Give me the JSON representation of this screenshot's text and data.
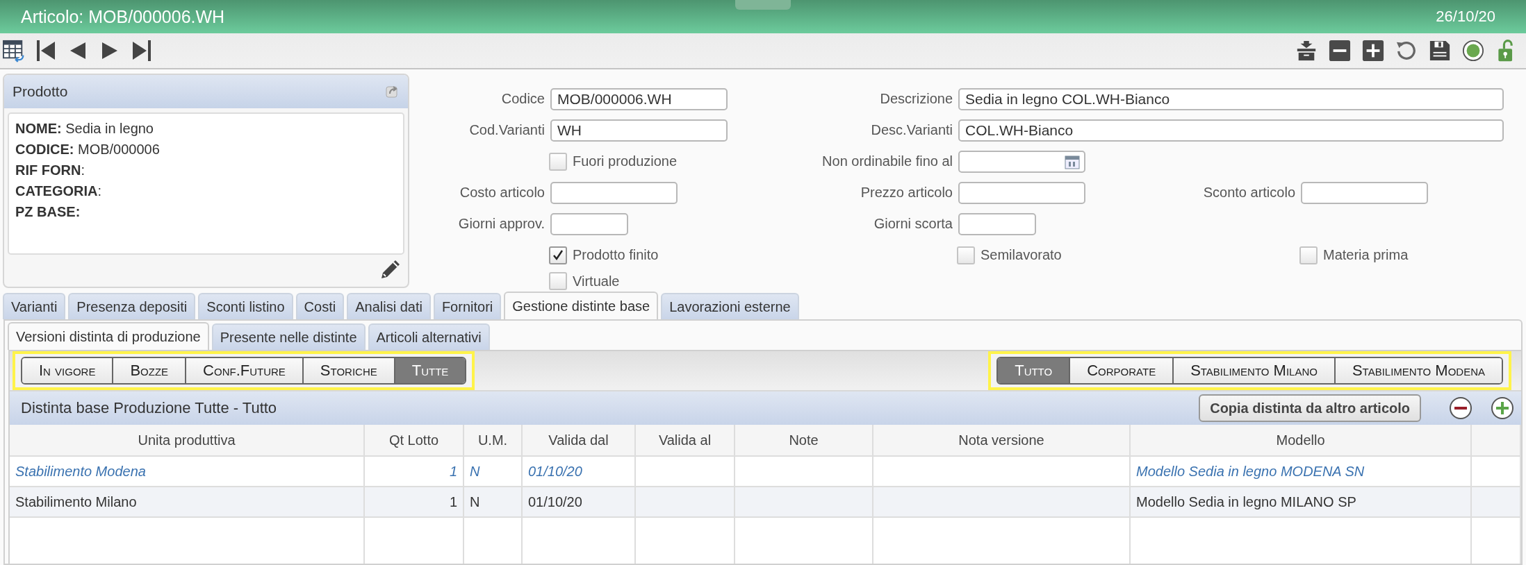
{
  "window": {
    "title": "Articolo: MOB/000006.WH",
    "date": "26/10/20"
  },
  "product": {
    "title": "Prodotto",
    "lines": [
      "**NOME:** Sedia in legno",
      "**CODICE:** MOB/000006",
      "**RIF FORN**:",
      "**CATEGORIA**:",
      "**PZ BASE:**"
    ]
  },
  "form": {
    "codice": {
      "label": "Codice",
      "value": "MOB/000006.WH"
    },
    "descrizione": {
      "label": "Descrizione",
      "value": "Sedia in legno COL.WH-Bianco"
    },
    "cod_varianti": {
      "label": "Cod.Varianti",
      "value": "WH"
    },
    "desc_varianti": {
      "label": "Desc.Varianti",
      "value": "COL.WH-Bianco"
    },
    "fuori_produzione": {
      "label": "Fuori produzione",
      "checked": false
    },
    "non_ordinabile": {
      "label": "Non ordinabile fino al"
    },
    "costo_articolo": {
      "label": "Costo articolo"
    },
    "prezzo_articolo": {
      "label": "Prezzo articolo"
    },
    "sconto_articolo": {
      "label": "Sconto articolo"
    },
    "giorni_approv": {
      "label": "Giorni approv."
    },
    "giorni_scorta": {
      "label": "Giorni scorta"
    },
    "prodotto_finito": {
      "label": "Prodotto finito",
      "checked": true
    },
    "semilavorato": {
      "label": "Semilavorato",
      "checked": false
    },
    "materia_prima": {
      "label": "Materia prima",
      "checked": false
    },
    "virtuale": {
      "label": "Virtuale",
      "checked": false
    }
  },
  "tabs": [
    {
      "label": "Varianti",
      "selected": false
    },
    {
      "label": "Presenza depositi",
      "selected": false
    },
    {
      "label": "Sconti listino",
      "selected": false
    },
    {
      "label": "Costi",
      "selected": false
    },
    {
      "label": "Analisi dati",
      "selected": false
    },
    {
      "label": "Fornitori",
      "selected": false
    },
    {
      "label": "Gestione distinte base",
      "selected": true
    },
    {
      "label": "Lavorazioni esterne",
      "selected": false
    }
  ],
  "subtabs": [
    {
      "label": "Versioni distinta di produzione",
      "selected": true
    },
    {
      "label": "Presente nelle distinte",
      "selected": false
    },
    {
      "label": "Articoli alternativi",
      "selected": false
    }
  ],
  "status_filter": [
    {
      "label": "In vigore",
      "selected": false
    },
    {
      "label": "Bozze",
      "selected": false
    },
    {
      "label": "Conf.Future",
      "selected": false
    },
    {
      "label": "Storiche",
      "selected": false
    },
    {
      "label": "Tutte",
      "selected": true
    }
  ],
  "plant_filter": [
    {
      "label": "Tutto",
      "selected": true
    },
    {
      "label": "Corporate",
      "selected": false
    },
    {
      "label": "Stabilimento Milano",
      "selected": false
    },
    {
      "label": "Stabilimento Modena",
      "selected": false
    }
  ],
  "grid": {
    "title": "Distinta base Produzione Tutte - Tutto",
    "copy_button": "Copia distinta da altro articolo",
    "columns": [
      "Unita produttiva",
      "Qt Lotto",
      "U.M.",
      "Valida dal",
      "Valida al",
      "Note",
      "Nota versione",
      "Modello"
    ],
    "rows": [
      {
        "unita_produttiva": "Stabilimento Modena",
        "qt_lotto": "1",
        "um": "N",
        "valida_dal": "01/10/20",
        "modello": "Modello Sedia in legno MODENA SN",
        "selected": true
      },
      {
        "unita_produttiva": "Stabilimento Milano",
        "qt_lotto": "1",
        "um": "N",
        "valida_dal": "01/10/20",
        "modello": "Modello Sedia in legno MILANO SP",
        "selected": false
      }
    ]
  }
}
